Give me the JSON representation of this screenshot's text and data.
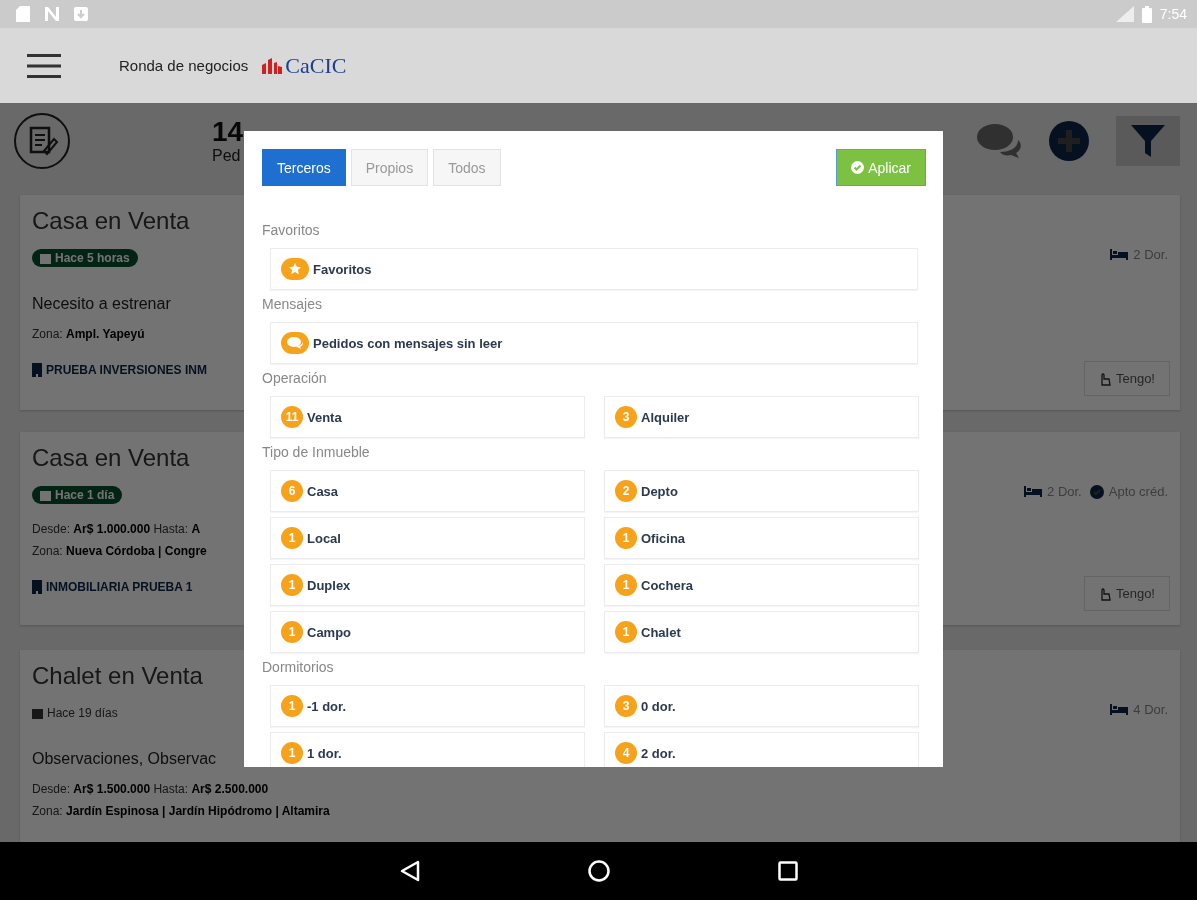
{
  "status_bar": {
    "time": "7:54"
  },
  "app_bar": {
    "title": "Ronda de negocios",
    "brand": "CaCIC"
  },
  "summary": {
    "count": "14",
    "label": "Ped"
  },
  "cards": [
    {
      "title": "Casa en Venta",
      "date": {
        "text": "Hace 5 horas",
        "recent": true
      },
      "lines": [
        {
          "kind": "heading",
          "text": "Necesito a estrenar"
        },
        {
          "kind": "detail",
          "text": "Zona: **Ampl. Yapeyú**"
        },
        {
          "kind": "agency",
          "text": "PRUEBA INVERSIONES INM"
        }
      ],
      "features": [
        {
          "kind": "bedrooms",
          "text": "2 Dor."
        }
      ],
      "action": "Tengo!"
    },
    {
      "title": "Casa en Venta",
      "date": {
        "text": "Hace 1 día",
        "recent": true
      },
      "lines": [
        {
          "kind": "detail",
          "text": "Desde: **Ar$ 1.000.000** Hasta: **A**"
        },
        {
          "kind": "detail",
          "text": "Zona: **Nueva Córdoba | Congre**"
        },
        {
          "kind": "agency",
          "text": "INMOBILIARIA PRUEBA 1"
        }
      ],
      "features": [
        {
          "kind": "bedrooms",
          "text": "2 Dor."
        },
        {
          "kind": "credit",
          "text": "Apto créd."
        }
      ],
      "action": "Tengo!"
    },
    {
      "title": "Chalet en Venta",
      "date": {
        "text": "Hace 19 días",
        "recent": false
      },
      "lines": [
        {
          "kind": "heading",
          "text": "Observaciones, Observac"
        },
        {
          "kind": "detail",
          "text": "Desde: **Ar$ 1.500.000** Hasta: **Ar$ 2.500.000**"
        },
        {
          "kind": "detail",
          "text": "Zona: **Jardín Espinosa | Jardín Hipódromo | Altamira**"
        }
      ],
      "features": [
        {
          "kind": "bedrooms",
          "text": "4 Dor."
        }
      ]
    }
  ],
  "filter_dialog": {
    "tabs": [
      {
        "label": "Terceros",
        "selected": true
      },
      {
        "label": "Propios",
        "selected": false
      },
      {
        "label": "Todos",
        "selected": false
      }
    ],
    "apply_button": "Aplicar",
    "sections": [
      {
        "title": "Favoritos",
        "items": [
          {
            "kind": "favorite",
            "label": "Favoritos"
          }
        ]
      },
      {
        "title": "Mensajes",
        "items": [
          {
            "kind": "messages",
            "label": "Pedidos con mensajes sin leer"
          }
        ]
      },
      {
        "title": "Operación",
        "items": [
          {
            "kind": "count",
            "count": "11",
            "label": "Venta"
          },
          {
            "kind": "count",
            "count": "3",
            "label": "Alquiler"
          }
        ]
      },
      {
        "title": "Tipo de Inmueble",
        "items": [
          {
            "kind": "count",
            "count": "6",
            "label": "Casa"
          },
          {
            "kind": "count",
            "count": "2",
            "label": "Depto"
          },
          {
            "kind": "count",
            "count": "1",
            "label": "Local"
          },
          {
            "kind": "count",
            "count": "1",
            "label": "Oficina"
          },
          {
            "kind": "count",
            "count": "1",
            "label": "Duplex"
          },
          {
            "kind": "count",
            "count": "1",
            "label": "Cochera"
          },
          {
            "kind": "count",
            "count": "1",
            "label": "Campo"
          },
          {
            "kind": "count",
            "count": "1",
            "label": "Chalet"
          }
        ]
      },
      {
        "title": "Dormitorios",
        "items": [
          {
            "kind": "count",
            "count": "1",
            "label": "-1 dor."
          },
          {
            "kind": "count",
            "count": "3",
            "label": "0 dor."
          },
          {
            "kind": "count",
            "count": "1",
            "label": "1 dor."
          },
          {
            "kind": "count",
            "count": "4",
            "label": "2 dor."
          }
        ]
      }
    ]
  }
}
